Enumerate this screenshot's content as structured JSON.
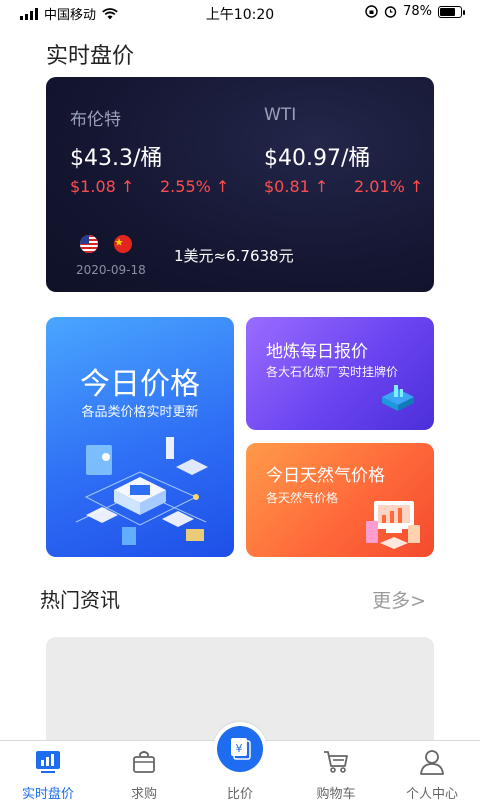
{
  "status_bar": {
    "carrier": "中国移动",
    "time": "上午10:20",
    "battery_percent": "78%",
    "battery_level": 0.78
  },
  "realtime": {
    "title": "实时盘价",
    "items": [
      {
        "name": "布伦特",
        "price": "$43.3/桶",
        "change": "$1.08",
        "change_pct": "2.55%"
      },
      {
        "name": "WTI",
        "price": "$40.97/桶",
        "change": "$0.81",
        "change_pct": "2.01%"
      }
    ],
    "date": "2020-09-18",
    "exchange_rate": "1美元≈6.7638元",
    "up_arrow": "↑"
  },
  "features": {
    "today_price": {
      "title": "今日价格",
      "subtitle": "各品类价格实时更新"
    },
    "refinery": {
      "title": "地炼每日报价",
      "subtitle": "各大石化炼厂实时挂牌价"
    },
    "gas": {
      "title": "今日天然气价格",
      "subtitle": "各天然气价格"
    }
  },
  "news": {
    "title": "热门资讯",
    "more": "更多>"
  },
  "tabbar": {
    "items": [
      {
        "label": "实时盘价",
        "icon": "chart-icon"
      },
      {
        "label": "求购",
        "icon": "basket-icon"
      },
      {
        "label": "比价",
        "icon": "yen-icon"
      },
      {
        "label": "购物车",
        "icon": "cart-icon"
      },
      {
        "label": "个人中心",
        "icon": "user-icon"
      }
    ],
    "center_symbol": "¥"
  },
  "colors": {
    "accent": "#1e6cf0",
    "up": "#ff4d4f",
    "card_dark": "#151733"
  }
}
